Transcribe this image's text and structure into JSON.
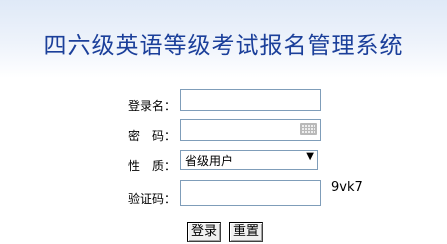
{
  "header": {
    "title": "四六级英语等级考试报名管理系统"
  },
  "form": {
    "username": {
      "label": "登录名：",
      "value": ""
    },
    "password": {
      "label": "密　码：",
      "value": ""
    },
    "nature": {
      "label": "性　质：",
      "selected": "省级用户"
    },
    "captcha": {
      "label": "验证码：",
      "value": "",
      "code": "9vk7"
    }
  },
  "buttons": {
    "login": "登录",
    "reset": "重置"
  },
  "icons": {
    "keyboard": "keyboard-icon",
    "dropdown": "chevron-down-icon"
  }
}
